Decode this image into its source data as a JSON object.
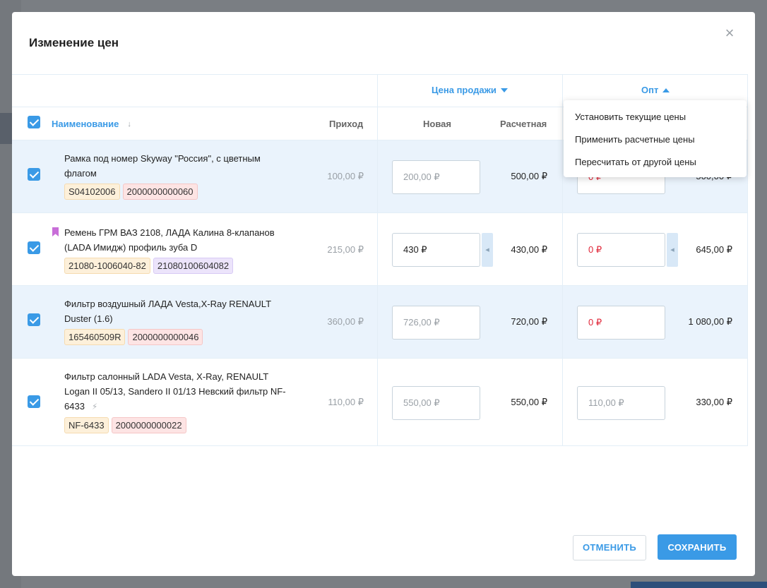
{
  "modal": {
    "title": "Изменение цен"
  },
  "header": {
    "group_sale": "Цена продажи",
    "group_opt": "Опт",
    "col_name": "Наименование",
    "col_income": "Приход",
    "col_new": "Новая",
    "col_calc": "Расчетная"
  },
  "dropdown": {
    "items": [
      "Установить текущие цены",
      "Применить расчетные цены",
      "Пересчитать от другой цены"
    ]
  },
  "rows": [
    {
      "name": "Рамка под номер Skyway \"Россия\", с цветным флагом",
      "tags": [
        "S04102006",
        "2000000000060"
      ],
      "income": "100,00 ₽",
      "sale_new": "200,00 ₽",
      "sale_calc": "500,00 ₽",
      "opt_new": "0 ₽",
      "opt_calc": "500,00 ₽"
    },
    {
      "name": "Ремень ГРМ ВАЗ 2108, ЛАДА Калина 8-клапанов (LADA Имидж) профиль зуба D",
      "tags": [
        "21080-1006040-82",
        "21080100604082"
      ],
      "income": "215,00 ₽",
      "sale_new": "430 ₽",
      "sale_calc": "430,00 ₽",
      "opt_new": "0 ₽",
      "opt_calc": "645,00 ₽"
    },
    {
      "name": "Фильтр воздушный ЛАДА Vesta,X-Ray RENAULT Duster (1.6)",
      "tags": [
        "165460509R",
        "2000000000046"
      ],
      "income": "360,00 ₽",
      "sale_new": "726,00 ₽",
      "sale_calc": "720,00 ₽",
      "opt_new": "0 ₽",
      "opt_calc": "1 080,00 ₽"
    },
    {
      "name": "Фильтр салонный LADA Vesta, X-Ray, RENAULT Logan II 05/13, Sandero II 01/13 Невский фильтр NF-6433",
      "tags": [
        "NF-6433",
        "2000000000022"
      ],
      "income": "110,00 ₽",
      "sale_new": "550,00 ₽",
      "sale_calc": "550,00 ₽",
      "opt_new": "110,00 ₽",
      "opt_calc": "330,00 ₽"
    }
  ],
  "footer": {
    "cancel": "ОТМЕНИТЬ",
    "save": "СОХРАНИТЬ"
  },
  "colors": {
    "accent": "#3a9ae6",
    "error": "#e0283a",
    "row_highlight": "#eaf3fc"
  }
}
